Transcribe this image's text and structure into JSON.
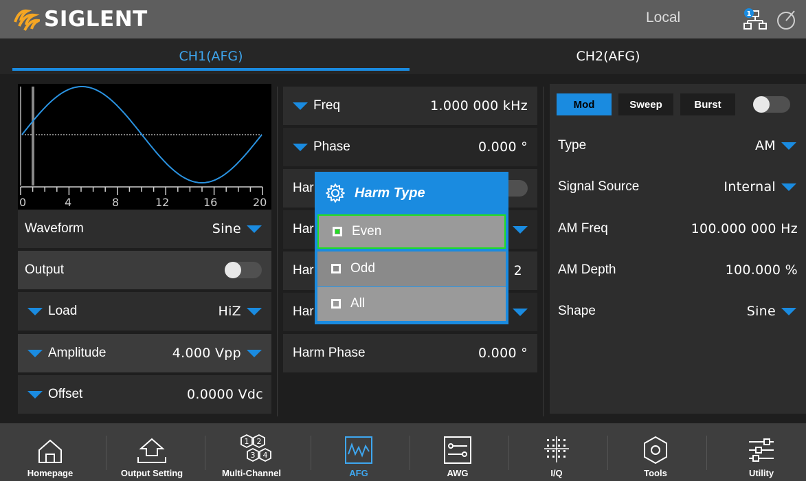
{
  "header": {
    "brand": "SIGLENT",
    "status": "Local",
    "network_badge": "1",
    "brand_color": "#f5a623",
    "accent": "#1a8be0"
  },
  "tabs": [
    {
      "label": "CH1(AFG)",
      "active": true
    },
    {
      "label": "CH2(AFG)",
      "active": false
    }
  ],
  "waveform_preview": {
    "x_ticks": [
      "0",
      "4",
      "8",
      "12",
      "16",
      "20"
    ]
  },
  "left_panel": {
    "waveform": {
      "label": "Waveform",
      "value": "Sine"
    },
    "output": {
      "label": "Output",
      "enabled": false
    },
    "load": {
      "label": "Load",
      "value": "HiZ"
    },
    "amplitude": {
      "label": "Amplitude",
      "value": "4.000 Vpp"
    },
    "offset": {
      "label": "Offset",
      "value": "0.0000 Vdc"
    }
  },
  "center_panel": {
    "freq": {
      "label": "Freq",
      "value": "1.000 000 kHz"
    },
    "phase": {
      "label": "Phase",
      "value": "0.000 °"
    },
    "row3_label": "Har",
    "row4_label": "Har",
    "row5_label": "Har",
    "row5_value": "2",
    "row6_label": "Har",
    "harm_phase": {
      "label": "Harm Phase",
      "value": "0.000 °"
    }
  },
  "harm_dialog": {
    "title": "Harm Type",
    "options": [
      {
        "label": "Even",
        "selected": true
      },
      {
        "label": "Odd",
        "selected": false
      },
      {
        "label": "All",
        "selected": false
      }
    ]
  },
  "right_panel": {
    "modes": [
      {
        "label": "Mod",
        "active": true
      },
      {
        "label": "Sweep",
        "active": false
      },
      {
        "label": "Burst",
        "active": false
      }
    ],
    "mod_enabled": false,
    "type": {
      "label": "Type",
      "value": "AM"
    },
    "signal_source": {
      "label": "Signal Source",
      "value": "Internal"
    },
    "am_freq": {
      "label": "AM Freq",
      "value": "100.000 000 Hz"
    },
    "am_depth": {
      "label": "AM Depth",
      "value": "100.000 %"
    },
    "shape": {
      "label": "Shape",
      "value": "Sine"
    }
  },
  "bottom_nav": [
    {
      "label": "Homepage",
      "icon": "home-icon",
      "active": false
    },
    {
      "label": "Output Setting",
      "icon": "output-icon",
      "active": false
    },
    {
      "label": "Multi-Channel",
      "icon": "multichannel-icon",
      "active": false
    },
    {
      "label": "AFG",
      "icon": "afg-icon",
      "active": true
    },
    {
      "label": "AWG",
      "icon": "awg-icon",
      "active": false
    },
    {
      "label": "I/Q",
      "icon": "iq-icon",
      "active": false
    },
    {
      "label": "Tools",
      "icon": "tools-icon",
      "active": false
    },
    {
      "label": "Utility",
      "icon": "utility-icon",
      "active": false
    }
  ]
}
